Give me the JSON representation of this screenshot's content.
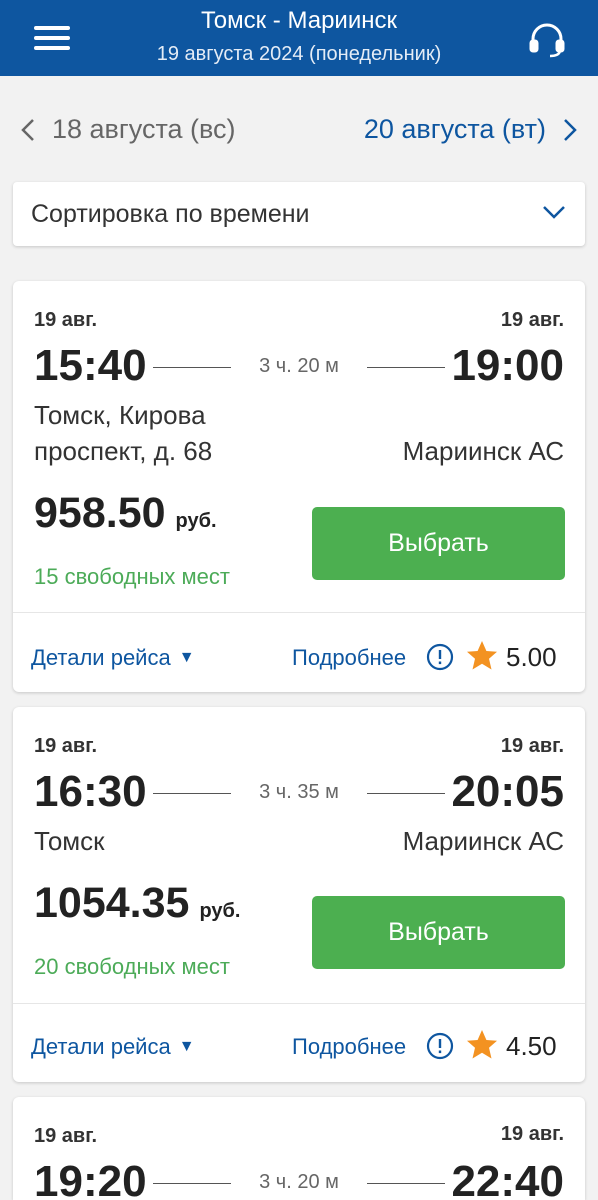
{
  "header": {
    "title": "Томск - Мариинск",
    "subtitle": "19 августа 2024 (понедельник)",
    "menu_icon": "hamburger-menu-icon",
    "support_icon": "headset-support-icon"
  },
  "day_nav": {
    "prev_label": "18 августа (вс)",
    "next_label": "20 августа (вт)"
  },
  "sort": {
    "label": "Сортировка по времени"
  },
  "colors": {
    "header": "#0e56a0",
    "button": "#4caf50",
    "seats": "#4cab58",
    "link": "#0e56a0",
    "star": "#f39221"
  },
  "trips": [
    {
      "dep_date": "19 авг.",
      "arr_date": "19 авг.",
      "dep_time": "15:40",
      "arr_time": "19:00",
      "duration": "3 ч. 20 м",
      "from_line1": "Томск, Кирова",
      "from_line2": "проспект, д. 68",
      "to": "Мариинск АС",
      "price": "958.50",
      "currency": "руб.",
      "seats": "15 свободных мест",
      "select_label": "Выбрать",
      "details_label": "Детали рейса",
      "more_label": "Подробнее",
      "rating": "5.00"
    },
    {
      "dep_date": "19 авг.",
      "arr_date": "19 авг.",
      "dep_time": "16:30",
      "arr_time": "20:05",
      "duration": "3 ч. 35 м",
      "from_line1": "Томск",
      "to": "Мариинск АС",
      "price": "1054.35",
      "currency": "руб.",
      "seats": "20 свободных мест",
      "select_label": "Выбрать",
      "details_label": "Детали рейса",
      "more_label": "Подробнее",
      "rating": "4.50"
    },
    {
      "dep_date": "19 авг.",
      "arr_date": "19 авг.",
      "dep_time": "19:20",
      "arr_time": "22:40",
      "duration": "3 ч. 20 м"
    }
  ]
}
